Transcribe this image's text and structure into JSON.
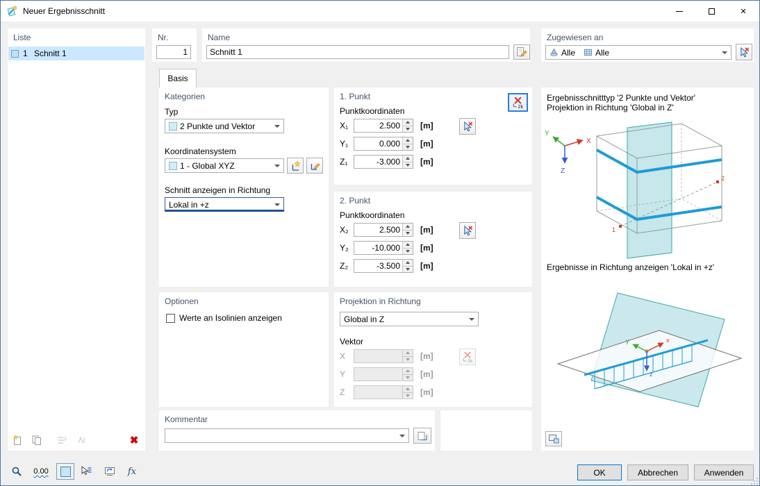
{
  "window": {
    "title": "Neuer Ergebnisschnitt"
  },
  "liste": {
    "title": "Liste",
    "items": [
      {
        "nr": "1",
        "name": "Schnitt 1"
      }
    ]
  },
  "header": {
    "nr": {
      "label": "Nr.",
      "value": "1"
    },
    "name": {
      "label": "Name",
      "value": "Schnitt 1"
    },
    "zugewiesen": {
      "label": "Zugewiesen an",
      "value1": "Alle",
      "value2": "Alle"
    }
  },
  "tabs": {
    "basis": "Basis"
  },
  "kategorien": {
    "title": "Kategorien",
    "typ": {
      "label": "Typ",
      "value": "2 Punkte und Vektor"
    },
    "koordinatensystem": {
      "label": "Koordinatensystem",
      "value": "1 - Global XYZ"
    },
    "richtung": {
      "label": "Schnitt anzeigen in Richtung",
      "value": "Lokal in +z"
    }
  },
  "punkt1": {
    "title": "1. Punkt",
    "koordinaten_label": "Punktkoordinaten",
    "fields": [
      {
        "label": "X₁",
        "value": "2.500",
        "unit": "[m]"
      },
      {
        "label": "Y₁",
        "value": "0.000",
        "unit": "[m]"
      },
      {
        "label": "Z₁",
        "value": "-3.000",
        "unit": "[m]"
      }
    ]
  },
  "punkt2": {
    "title": "2. Punkt",
    "koordinaten_label": "Punktkoordinaten",
    "fields": [
      {
        "label": "X₂",
        "value": "2.500",
        "unit": "[m]"
      },
      {
        "label": "Y₂",
        "value": "-10.000",
        "unit": "[m]"
      },
      {
        "label": "Z₂",
        "value": "-3.500",
        "unit": "[m]"
      }
    ]
  },
  "optionen": {
    "title": "Optionen",
    "isolinien": "Werte an Isolinien anzeigen",
    "isolinien_checked": false
  },
  "projektion": {
    "title": "Projektion in Richtung",
    "value": "Global in Z",
    "vektor_label": "Vektor",
    "fields": [
      {
        "label": "X",
        "value": "",
        "unit": "[m]"
      },
      {
        "label": "Y",
        "value": "",
        "unit": "[m]"
      },
      {
        "label": "Z",
        "value": "",
        "unit": "[m]"
      }
    ]
  },
  "kommentar": {
    "title": "Kommentar",
    "value": ""
  },
  "preview": {
    "caption1a": "Ergebnisschnitttyp '2 Punkte und Vektor'",
    "caption1b": "Projektion in Richtung 'Global in Z'",
    "caption2": "Ergebnisse in Richtung anzeigen 'Lokal in +z'",
    "point1": "1",
    "point2": "2",
    "axes1": {
      "x": "X",
      "y": "Y",
      "z": "Z"
    },
    "axes2": {
      "x": "x",
      "y": "y",
      "z": "z"
    }
  },
  "footer": {
    "ok": "OK",
    "cancel": "Abbrechen",
    "apply": "Anwenden",
    "units": "0.00"
  },
  "colors": {
    "accent": "#0078d7",
    "selection": "#cce8ff",
    "section_blue": "#1e9cd7",
    "plane_teal": "#3aa7b0"
  }
}
